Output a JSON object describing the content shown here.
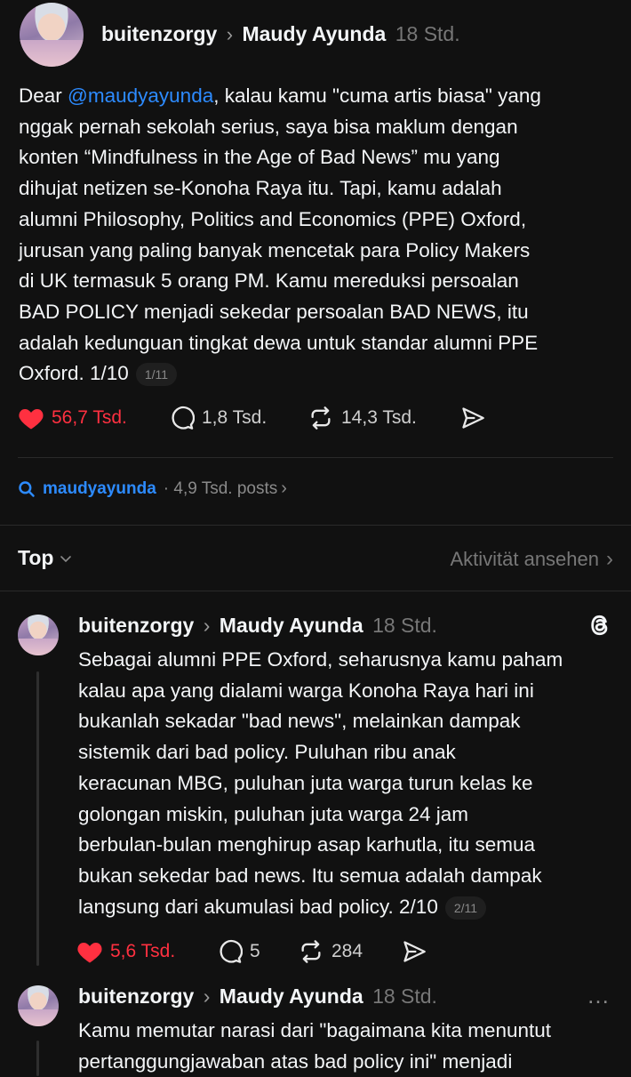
{
  "post": {
    "author": "buitenzorgy",
    "recipient": "Maudy Ayunda",
    "time": "18 Std.",
    "lines": [
      {
        "prefix": "Dear ",
        "mention": "@maudyayunda",
        "text": ", kalau kamu \"cuma artis biasa\" yang"
      },
      {
        "text": "nggak pernah sekolah serius, saya bisa maklum dengan"
      },
      {
        "text": "konten “Mindfulness in the Age of Bad News” mu yang"
      },
      {
        "text": "dihujat netizen se-Konoha Raya itu. Tapi, kamu adalah"
      },
      {
        "text": "alumni Philosophy, Politics and Economics (PPE) Oxford,"
      },
      {
        "text": "jurusan yang paling banyak mencetak para Policy Makers"
      },
      {
        "text": "di UK termasuk 5 orang PM. Kamu mereduksi persoalan"
      },
      {
        "text": "BAD POLICY menjadi sekedar persoalan BAD NEWS, itu"
      },
      {
        "text": "adalah kedunguan tingkat dewa untuk standar alumni PPE"
      },
      {
        "text": "Oxford.  1/10"
      }
    ],
    "page_badge": "1/11",
    "likes": "56,7 Tsd.",
    "comments": "1,8 Tsd.",
    "reposts": "14,3 Tsd."
  },
  "topic_link": {
    "name": "maudyayunda",
    "meta": "· 4,9 Tsd. posts"
  },
  "sort_bar": {
    "label": "Top",
    "activity": "Aktivität ansehen"
  },
  "reply1": {
    "author": "buitenzorgy",
    "recipient": "Maudy Ayunda",
    "time": "18 Std.",
    "lines": [
      "Sebagai alumni PPE Oxford, seharusnya kamu paham",
      "kalau apa yang dialami warga Konoha Raya hari ini",
      "bukanlah sekadar \"bad news\", melainkan dampak",
      "sistemik dari bad policy. Puluhan ribu anak",
      "keracunan MBG, puluhan juta warga turun kelas ke",
      "golongan miskin, puluhan juta warga 24 jam",
      "berbulan-bulan menghirup asap karhutla, itu semua",
      "bukan sekedar bad news. Itu semua adalah dampak",
      "langsung dari akumulasi bad policy. 2/10"
    ],
    "page_badge": "2/11",
    "likes": "5,6 Tsd.",
    "comments": "5",
    "reposts": "284"
  },
  "reply2": {
    "author": "buitenzorgy",
    "recipient": "Maudy Ayunda",
    "time": "18 Std.",
    "lines": [
      "Kamu memutar narasi dari \"bagaimana kita menuntut",
      "pertanggungjawaban atas bad policy ini\" menjadi"
    ]
  },
  "colors": {
    "background": "#111111",
    "like_red": "#ff3040",
    "link_blue": "#2d8bff",
    "muted": "#777777"
  }
}
